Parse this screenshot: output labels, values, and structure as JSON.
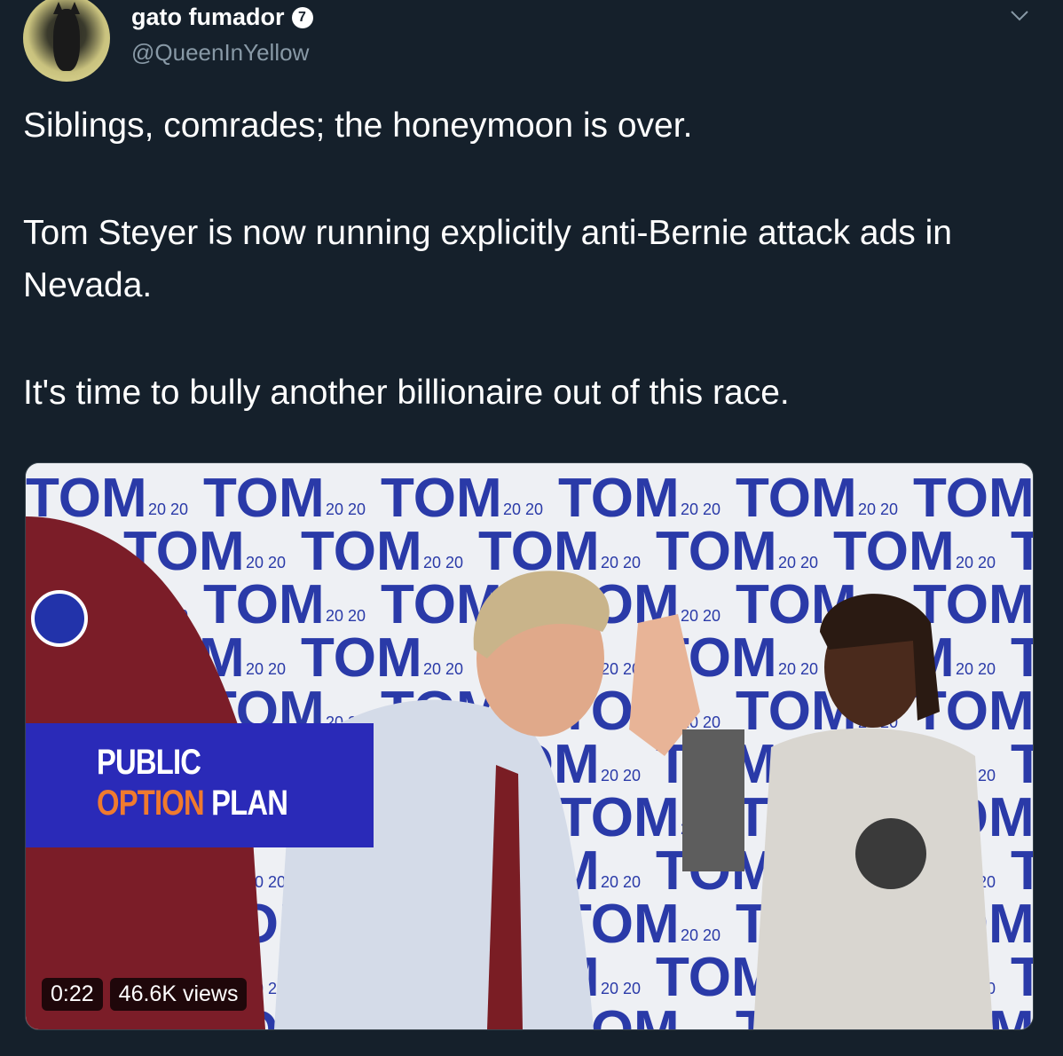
{
  "tweet": {
    "author_name": "gato fumador",
    "verified_label": "7",
    "handle": "@QueenInYellow",
    "text": {
      "line1": "Siblings, comrades; the honeymoon is over.",
      "line2": "Tom Steyer is now running explicitly anti-Bernie attack ads in Nevada.",
      "line3": "It's time to bully another billionaire out of this race."
    },
    "icons": {
      "more": "chevron-down-icon",
      "verified": "verified-badge-icon"
    }
  },
  "media": {
    "overlay": {
      "line1": "PUBLIC",
      "line2_a": "OPTION",
      "line2_b": "PLAN"
    },
    "backdrop_word": "TOM",
    "backdrop_year": "20 20",
    "duration": "0:22",
    "views": "46.6K views"
  },
  "colors": {
    "background": "#15202b",
    "secondary_text": "#8899a6",
    "overlay_blue": "#2a2ab8",
    "overlay_orange": "#f07a2e"
  }
}
